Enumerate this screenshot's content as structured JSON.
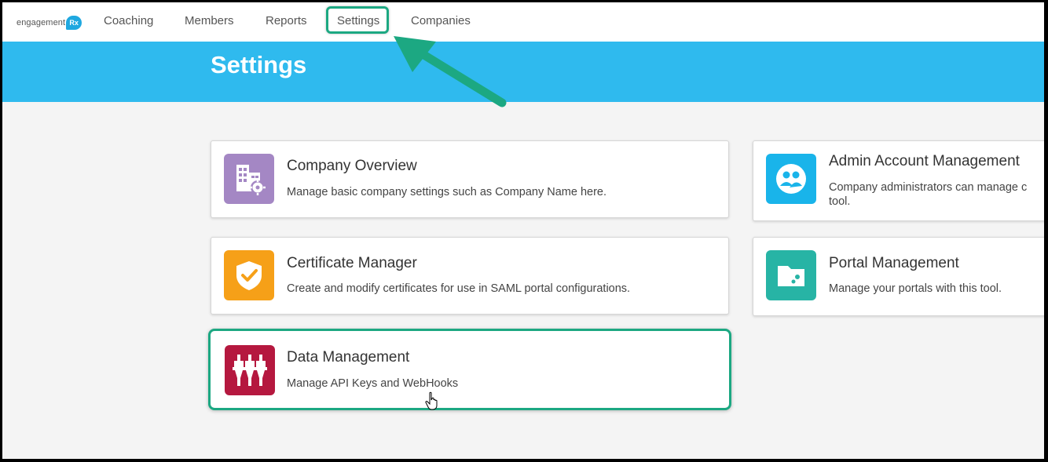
{
  "brand": {
    "logo_text": "engagement",
    "logo_badge": "Rx",
    "accent": "#2fbaee",
    "highlight": "#1ca882"
  },
  "nav": {
    "items": [
      "Coaching",
      "Members",
      "Reports",
      "Settings",
      "Companies"
    ],
    "active": "Settings"
  },
  "page": {
    "title": "Settings"
  },
  "cards": [
    {
      "title": "Company Overview",
      "desc": "Manage basic company settings such as Company Name here.",
      "icon": "building-gear-icon",
      "color": "#a487c4"
    },
    {
      "title": "Admin Account Management",
      "desc": "Company administrators can manage c tool.",
      "icon": "users-circle-icon",
      "color": "#19b4ea"
    },
    {
      "title": "Certificate Manager",
      "desc": "Create and modify certificates for use in SAML portal configurations.",
      "icon": "shield-check-icon",
      "color": "#f6a018"
    },
    {
      "title": "Portal Management",
      "desc": "Manage your portals with this tool.",
      "icon": "folder-icon",
      "color": "#27b4a5"
    },
    {
      "title": "Data Management",
      "desc": "Manage API Keys and WebHooks",
      "icon": "plugs-icon",
      "color": "#b5183f"
    }
  ]
}
